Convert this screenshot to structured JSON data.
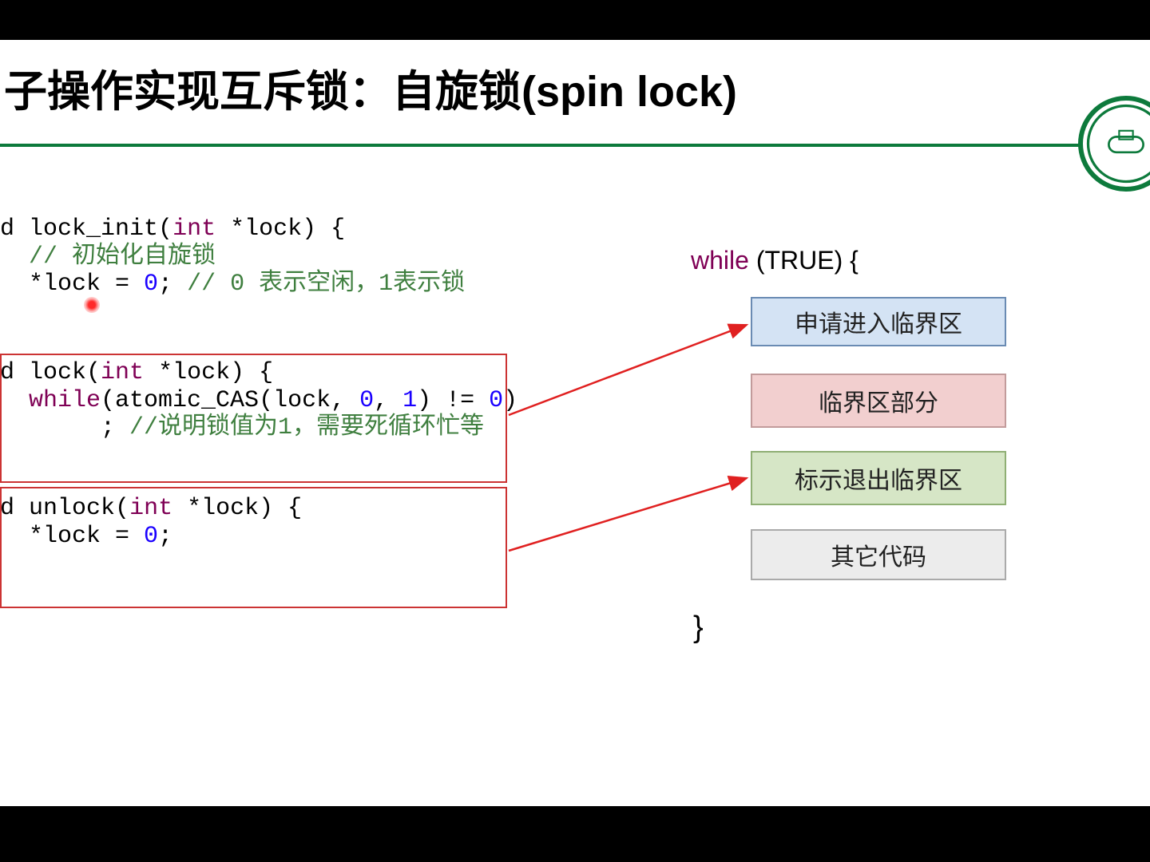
{
  "title_prefix": "子操作实现互斥锁：自旋锁",
  "title_spin": "(spin lock)",
  "code_block1": {
    "sig_prefix": "d ",
    "fn": "lock_init",
    "sig_params": "(int *lock) {",
    "comment1": "  // 初始化自旋锁",
    "assign_stmt": "  *lock = ",
    "assign_val": "0",
    "assign_after": "; ",
    "comment2": "// 0 表示空闲，1表示锁"
  },
  "code_block2": {
    "sig_prefix": "d ",
    "fn": "lock",
    "sig_params": "(int *lock) {",
    "while_kw": "  while",
    "while_call": "(atomic_CAS(lock, ",
    "arg0": "0",
    "sep": ", ",
    "arg1": "1",
    "tail": ") != ",
    "cmp": "0",
    "close": ")",
    "body": "       ; ",
    "comment": "//说明锁值为1，需要死循环忙等"
  },
  "code_block3": {
    "sig_prefix": "d ",
    "fn": "unlock",
    "sig_params": "(int *lock) {",
    "assign_stmt": "  *lock = ",
    "assign_val": "0",
    "assign_after": ";"
  },
  "while_loop": {
    "kw": "while",
    "cond": " (TRUE) {",
    "close": "}"
  },
  "boxes": {
    "b1": "申请进入临界区",
    "b2": "临界区部分",
    "b3": "标示退出临界区",
    "b4": "其它代码"
  }
}
